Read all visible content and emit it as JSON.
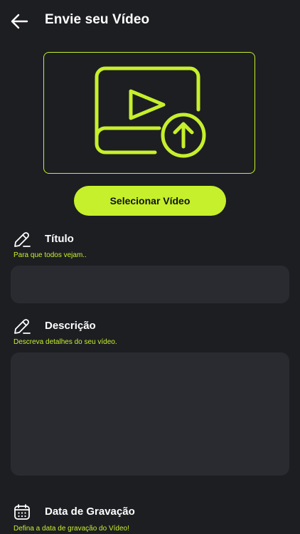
{
  "header": {
    "title": "Envie seu Vídeo",
    "back_icon": "arrow-left-icon"
  },
  "upload": {
    "icon": "video-upload-icon",
    "button_label": "Selecionar Vídeo"
  },
  "fields": {
    "title": {
      "icon": "pencil-icon",
      "label": "Título",
      "hint": "Para que todos vejam..",
      "value": ""
    },
    "description": {
      "icon": "pencil-icon",
      "label": "Descrição",
      "hint": "Descreva detalhes do seu vídeo.",
      "value": ""
    },
    "recording_date": {
      "icon": "calendar-icon",
      "label": "Data de Gravação",
      "hint": "Defina a data de gravação do Vídeo!"
    }
  },
  "colors": {
    "background": "#1d1e22",
    "accent": "#c6f02c",
    "input_bg": "#2a2b30",
    "text": "#ffffff"
  }
}
